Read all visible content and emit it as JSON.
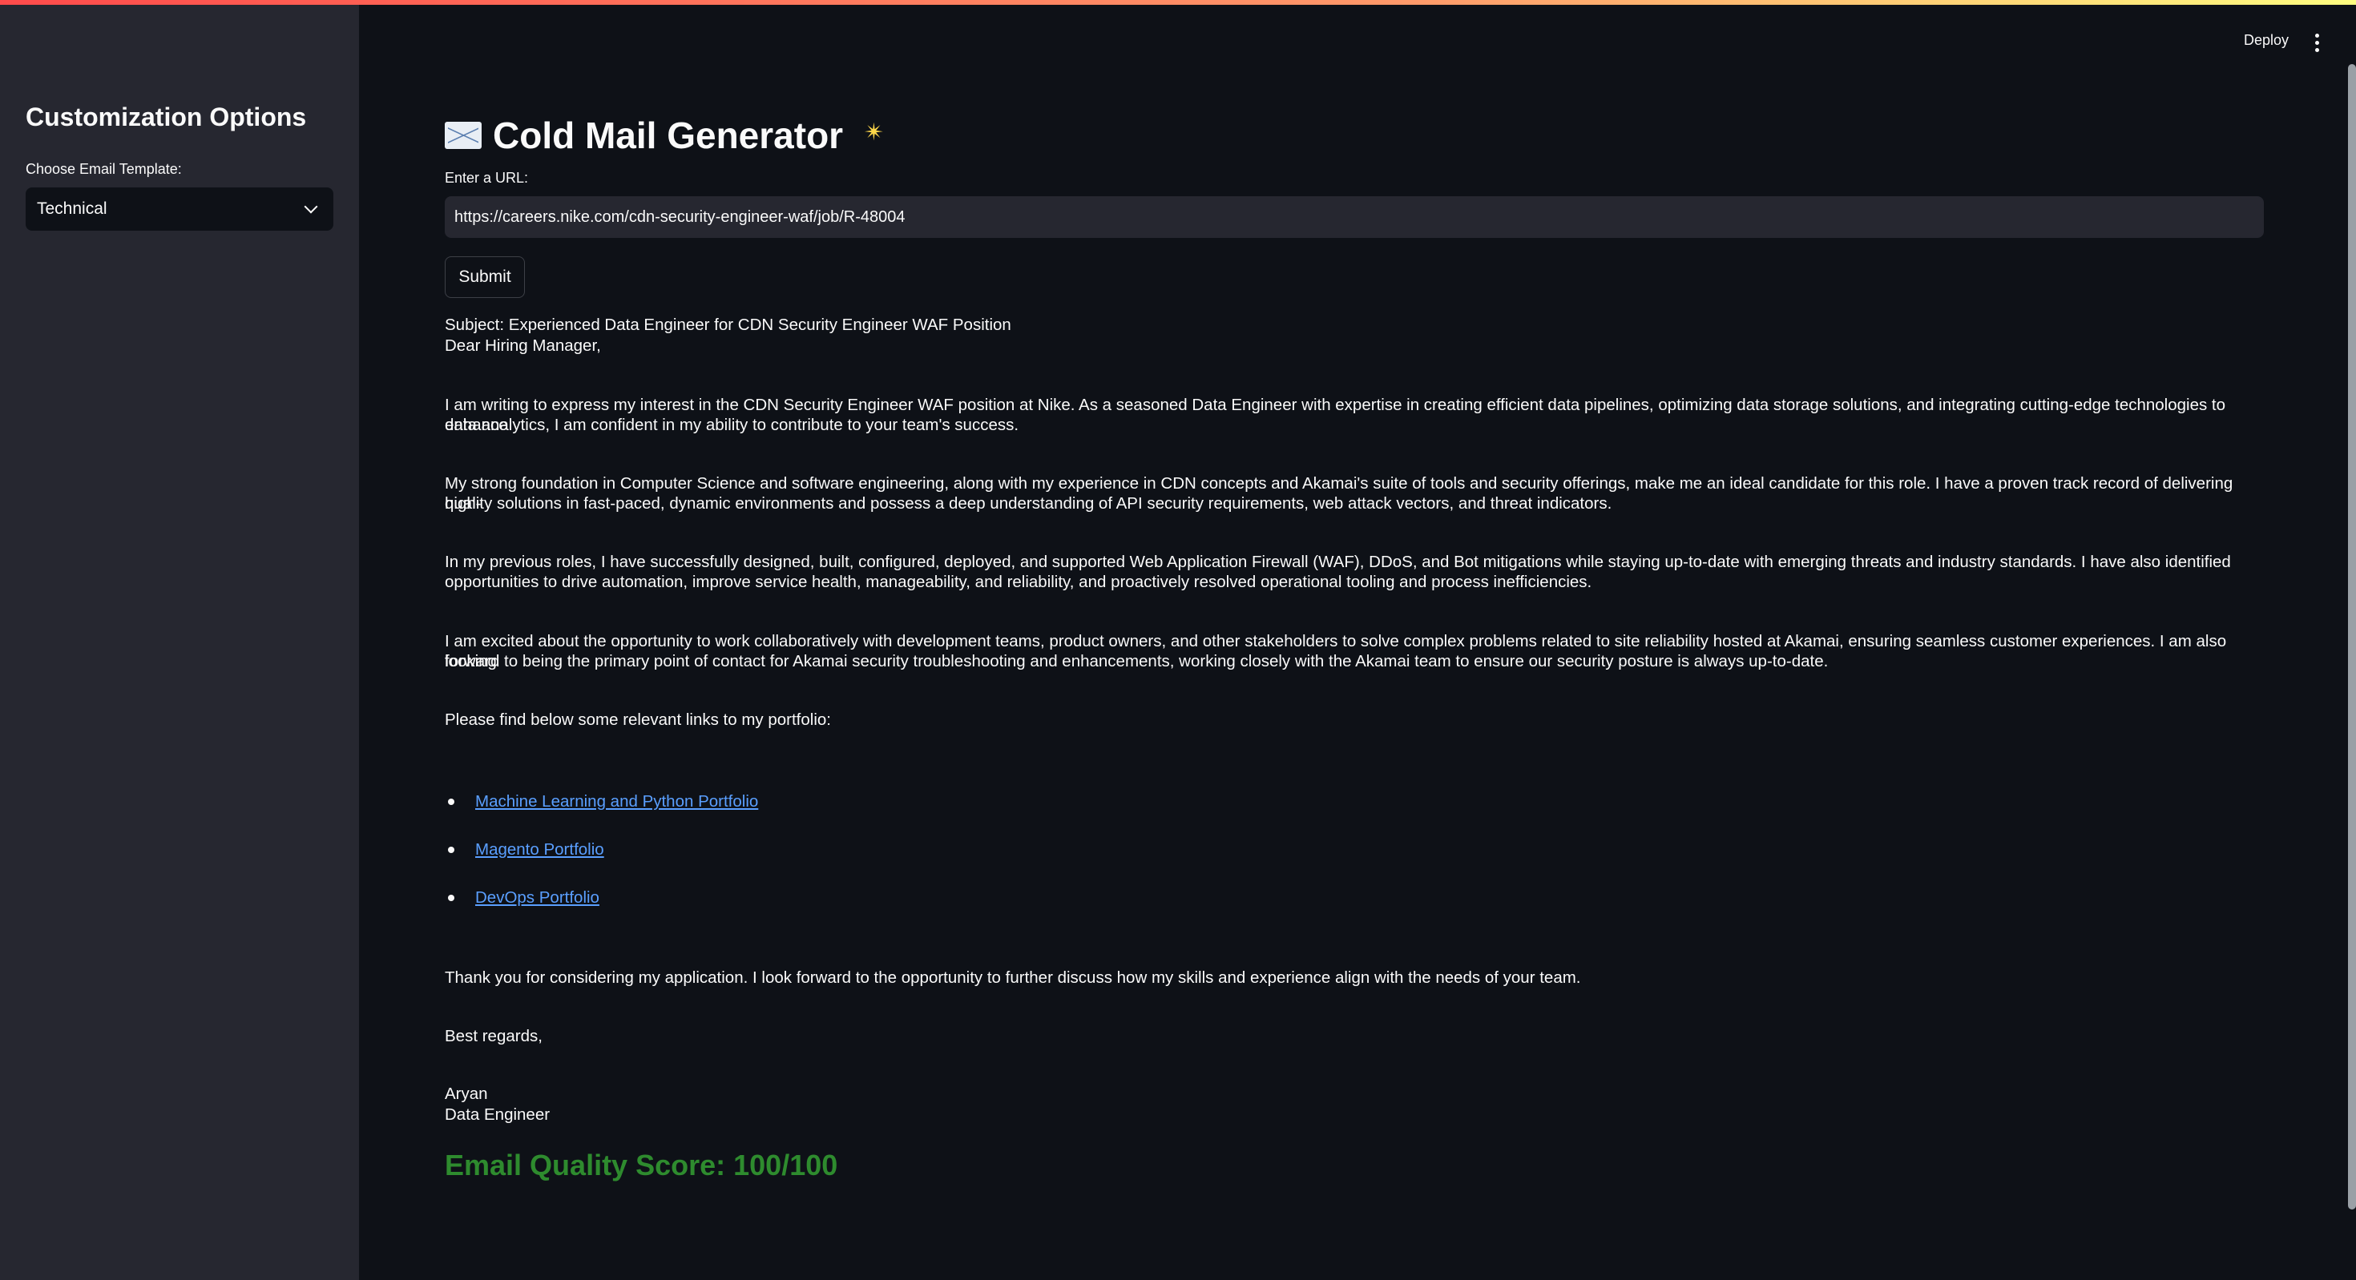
{
  "sidebar": {
    "title": "Customization Options",
    "template_label": "Choose Email Template:",
    "template_value": "Technical"
  },
  "header": {
    "deploy_label": "Deploy"
  },
  "main": {
    "title": "Cold Mail Generator",
    "title_icon": "envelope-icon",
    "title_sparkle": "✴",
    "url_label": "Enter a URL:",
    "url_value": "https://careers.nike.com/cdn-security-engineer-waf/job/R-48004",
    "submit_label": "Submit"
  },
  "email": {
    "subject": "Subject: Experienced Data Engineer for CDN Security Engineer WAF Position",
    "greeting": "Dear Hiring Manager,",
    "p1_line1": "I am writing to express my interest in the CDN Security Engineer WAF position at Nike. As a seasoned Data Engineer with expertise in creating efficient data pipelines, optimizing data storage solutions, and integrating cutting-edge technologies to enhance",
    "p1_line2": "data analytics, I am confident in my ability to contribute to your team's success.",
    "p2_line1": "My strong foundation in Computer Science and software engineering, along with my experience in CDN concepts and Akamai's suite of tools and security offerings, make me an ideal candidate for this role. I have a proven track record of delivering high-",
    "p2_line2": "quality solutions in fast-paced, dynamic environments and possess a deep understanding of API security requirements, web attack vectors, and threat indicators.",
    "p3_line1": "In my previous roles, I have successfully designed, built, configured, deployed, and supported Web Application Firewall (WAF), DDoS, and Bot mitigations while staying up-to-date with emerging threats and industry standards. I have also identified",
    "p3_line2": "opportunities to drive automation, improve service health, manageability, and reliability, and proactively resolved operational tooling and process inefficiencies.",
    "p4_line1": "I am excited about the opportunity to work collaboratively with development teams, product owners, and other stakeholders to solve complex problems related to site reliability hosted at Akamai, ensuring seamless customer experiences. I am also looking",
    "p4_line2": "forward to being the primary point of contact for Akamai security troubleshooting and enhancements, working closely with the Akamai team to ensure our security posture is always up-to-date.",
    "links_intro": "Please find below some relevant links to my portfolio:",
    "links": [
      "Machine Learning and Python Portfolio",
      "Magento Portfolio",
      "DevOps Portfolio"
    ],
    "thanks": "Thank you for considering my application. I look forward to the opportunity to further discuss how my skills and experience align with the needs of your team.",
    "closing": "Best regards,",
    "name": "Aryan",
    "role": "Data Engineer"
  },
  "score": {
    "text": "Email Quality Score: 100/100",
    "color": "#2e8b2e"
  }
}
